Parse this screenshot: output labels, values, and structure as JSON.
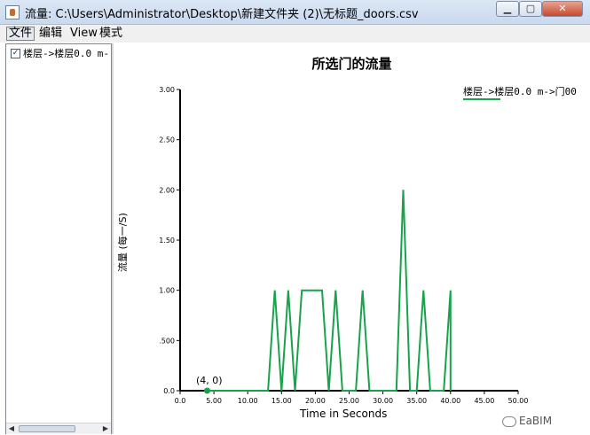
{
  "window": {
    "title": "流量: C:\\Users\\Administrator\\Desktop\\新建文件夹 (2)\\无标题_doors.csv",
    "buttons": {
      "minimize": "▁",
      "maximize": "▢",
      "close": "✕"
    }
  },
  "menu": {
    "file": "文件",
    "edit": "编辑",
    "view": "View",
    "mode": "模式"
  },
  "tree": {
    "items": [
      {
        "label": "楼层->楼层0.0 m-",
        "checked": true
      }
    ]
  },
  "scrollbar": {
    "left": "◀",
    "right": "▶",
    "grip": "III"
  },
  "chart_data": {
    "type": "line",
    "title": "所选门的流量",
    "xlabel": "Time in Seconds",
    "ylabel": "流量 (每一/S)",
    "xlim": [
      0,
      50
    ],
    "ylim": [
      0,
      3
    ],
    "x_ticks": [
      "0.0",
      "5.00",
      "10.00",
      "15.00",
      "20.00",
      "25.00",
      "30.00",
      "35.00",
      "40.00",
      "45.00",
      "50.00"
    ],
    "y_ticks": [
      "0.0",
      ".500",
      "1.00",
      "1.50",
      "2.00",
      "2.50",
      "3.00"
    ],
    "grid": false,
    "legend_position": "top-right",
    "series": [
      {
        "name": "楼层->楼层0.0 m->门00",
        "color": "#18a34a",
        "points": [
          [
            4,
            0
          ],
          [
            13,
            0
          ],
          [
            14,
            1
          ],
          [
            15,
            0
          ],
          [
            16,
            1
          ],
          [
            17,
            0
          ],
          [
            18,
            1
          ],
          [
            21,
            1
          ],
          [
            22,
            0
          ],
          [
            23,
            1
          ],
          [
            24,
            0
          ],
          [
            26,
            0
          ],
          [
            27,
            1
          ],
          [
            28,
            0
          ],
          [
            32,
            0
          ],
          [
            33,
            2
          ],
          [
            34,
            0
          ],
          [
            35,
            0
          ],
          [
            36,
            1
          ],
          [
            37,
            0
          ],
          [
            39,
            0
          ],
          [
            40,
            1
          ],
          [
            40,
            0
          ]
        ]
      }
    ],
    "annotation": {
      "text": "(4, 0)",
      "x": 4,
      "y": 0
    }
  },
  "watermark": {
    "text": "EaBIM"
  }
}
